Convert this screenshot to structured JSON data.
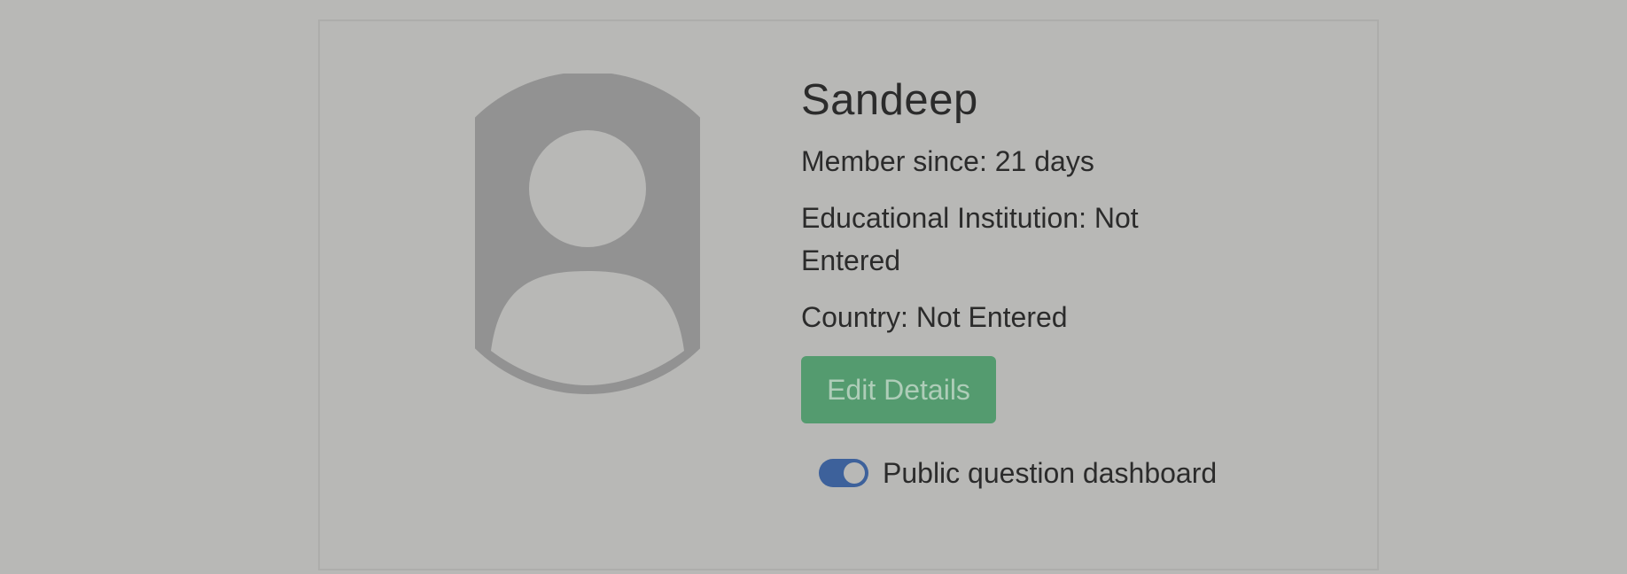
{
  "profile": {
    "name": "Sandeep",
    "member_since": "Member since: 21 days",
    "education": "Educational Institution: Not Entered",
    "country": "Country: Not Entered"
  },
  "actions": {
    "edit_label": "Edit Details"
  },
  "toggle": {
    "label": "Public question dashboard",
    "checked": true
  },
  "colors": {
    "background": "#b8b8b6",
    "avatar": "#929292",
    "edit_button": "#549b6f",
    "toggle_on": "#3d619b"
  },
  "icons": {
    "avatar": "user-silhouette-icon"
  }
}
